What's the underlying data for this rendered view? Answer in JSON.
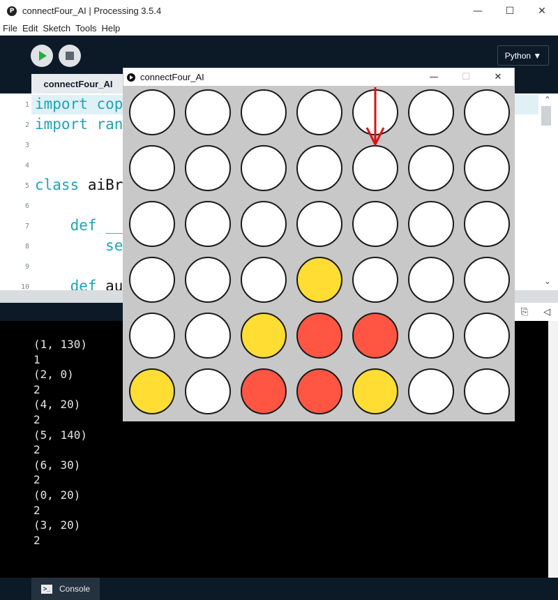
{
  "ide": {
    "title": "connectFour_AI | Processing 3.5.4",
    "app_icon_glyph": "P",
    "menu": [
      "File",
      "Edit",
      "Sketch",
      "Tools",
      "Help"
    ],
    "mode_label": "Python ▼",
    "tab_label": "connectFour_AI",
    "controls": {
      "minimize": "—",
      "maximize": "☐",
      "close": "✕"
    }
  },
  "editor": {
    "lines": [
      {
        "num": "1",
        "parts": [
          {
            "t": "import",
            "k": true
          },
          {
            "t": " cop",
            "k": true
          }
        ]
      },
      {
        "num": "2",
        "parts": [
          {
            "t": "import",
            "k": true
          },
          {
            "t": " ran",
            "k": true
          }
        ]
      },
      {
        "num": "3",
        "parts": []
      },
      {
        "num": "4",
        "parts": []
      },
      {
        "num": "5",
        "parts": [
          {
            "t": "class",
            "k": true
          },
          {
            "t": " aiBr",
            "k": false
          }
        ]
      },
      {
        "num": "6",
        "parts": []
      },
      {
        "num": "7",
        "parts": [
          {
            "t": "    def",
            "k": true
          },
          {
            "t": " __",
            "k": true
          }
        ]
      },
      {
        "num": "8",
        "parts": [
          {
            "t": "        se",
            "k": true
          }
        ]
      },
      {
        "num": "9",
        "parts": []
      },
      {
        "num": "10",
        "parts": [
          {
            "t": "    def",
            "k": true
          },
          {
            "t": " au",
            "k": false
          }
        ]
      }
    ]
  },
  "console": {
    "lines": [
      "(1, 130)",
      "1",
      "(2, 0)",
      "2",
      "(4, 20)",
      "2",
      "(5, 140)",
      "2",
      "(6, 30)",
      "2",
      "(0, 20)",
      "2",
      "(3, 20)",
      "2"
    ],
    "tab_label": "Console",
    "tab_icon_glyph": ">_"
  },
  "sketch": {
    "title": "connectFour_AI",
    "controls": {
      "minimize": "—",
      "maximize": "☐",
      "close": "✕"
    },
    "columns": 7,
    "rows": 6,
    "colors": {
      "empty": "#ffffff",
      "yellow": "#ffdd33",
      "red": "#ff5542",
      "arrow": "#dd1111",
      "board": "#c8c8c8"
    },
    "grid": [
      [
        "e",
        "e",
        "e",
        "e",
        "e",
        "e",
        "e"
      ],
      [
        "e",
        "e",
        "e",
        "e",
        "e",
        "e",
        "e"
      ],
      [
        "e",
        "e",
        "e",
        "e",
        "e",
        "e",
        "e"
      ],
      [
        "e",
        "e",
        "e",
        "y",
        "e",
        "e",
        "e"
      ],
      [
        "e",
        "e",
        "y",
        "r",
        "r",
        "e",
        "e"
      ],
      [
        "y",
        "e",
        "r",
        "r",
        "y",
        "e",
        "e"
      ]
    ],
    "arrow_column": 4
  }
}
